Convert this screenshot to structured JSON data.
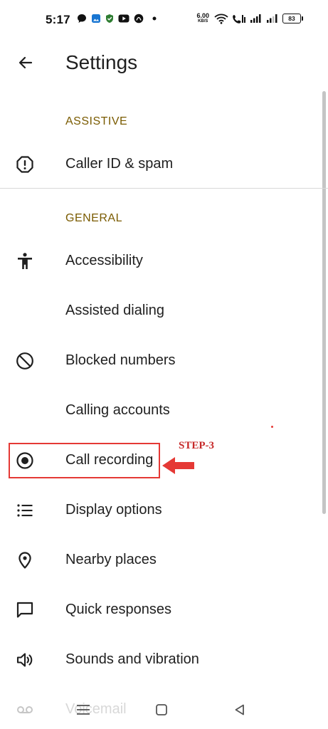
{
  "status_bar": {
    "time": "5:17",
    "net_speed_value": "6.00",
    "net_speed_unit": "KB/S",
    "battery": "83",
    "notification_icons": [
      "chat-bubble-icon",
      "gallery-icon",
      "shield-check-icon",
      "youtube-icon",
      "circle-app-icon",
      "dot-icon"
    ],
    "system_icons": [
      "wifi-icon",
      "volte-call-icon",
      "signal-icon-1",
      "signal-icon-2",
      "battery-icon"
    ]
  },
  "app_bar": {
    "title": "Settings",
    "back_icon": "arrow-left-icon"
  },
  "sections": [
    {
      "header": "ASSISTIVE",
      "items": [
        {
          "label": "Caller ID & spam",
          "icon": "alert-circle-icon"
        }
      ]
    },
    {
      "header": "GENERAL",
      "items": [
        {
          "label": "Accessibility",
          "icon": "accessibility-icon"
        },
        {
          "label": "Assisted dialing",
          "icon": ""
        },
        {
          "label": "Blocked numbers",
          "icon": "block-icon"
        },
        {
          "label": "Calling accounts",
          "icon": ""
        },
        {
          "label": "Call recording",
          "icon": "radio-record-icon"
        },
        {
          "label": "Display options",
          "icon": "list-icon"
        },
        {
          "label": "Nearby places",
          "icon": "location-pin-icon"
        },
        {
          "label": "Quick responses",
          "icon": "message-square-icon"
        },
        {
          "label": "Sounds and vibration",
          "icon": "speaker-icon"
        },
        {
          "label": "Voicemail",
          "icon": "voicemail-icon"
        }
      ]
    }
  ],
  "annotation": {
    "step_label": "STEP-3",
    "color": "#e53935"
  },
  "nav_bar": {
    "icons": [
      "menu-icon",
      "home-square-icon",
      "back-triangle-icon"
    ]
  },
  "colors": {
    "section_header": "#7a5b00",
    "text": "#1f1f1f",
    "divider": "#d9d9d9"
  }
}
